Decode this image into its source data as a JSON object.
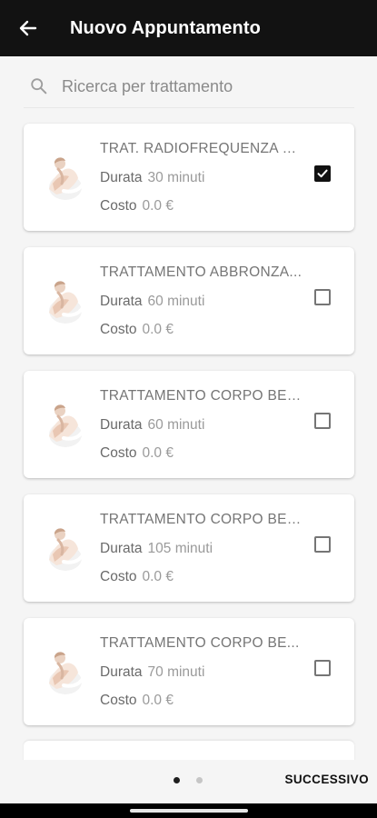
{
  "header": {
    "title": "Nuovo Appuntamento"
  },
  "search": {
    "placeholder": "Ricerca per trattamento"
  },
  "items": [
    {
      "title": "TRAT. RADIOFREQUENZA S...",
      "durata_label": "Durata",
      "durata": "30 minuti",
      "costo_label": "Costo",
      "costo": "0.0 €",
      "checked": true
    },
    {
      "title": "TRATTAMENTO ABBRONZA...",
      "durata_label": "Durata",
      "durata": "60 minuti",
      "costo_label": "Costo",
      "costo": "0.0 €",
      "checked": false
    },
    {
      "title": "TRATTAMENTO CORPO BE-...",
      "durata_label": "Durata",
      "durata": "60 minuti",
      "costo_label": "Costo",
      "costo": "0.0 €",
      "checked": false
    },
    {
      "title": "TRATTAMENTO CORPO BE-...",
      "durata_label": "Durata",
      "durata": "105 minuti",
      "costo_label": "Costo",
      "costo": "0.0 €",
      "checked": false
    },
    {
      "title": "TRATTAMENTO CORPO BE...",
      "durata_label": "Durata",
      "durata": "70 minuti",
      "costo_label": "Costo",
      "costo": "0.0 €",
      "checked": false
    }
  ],
  "pagination": {
    "current_page": 1,
    "total_pages": 2
  },
  "footer": {
    "next_label": "SUCCESSIVO"
  },
  "colors": {
    "appbar": "#121212",
    "background": "#f5f5f5",
    "checkbox_checked": "#111111"
  }
}
